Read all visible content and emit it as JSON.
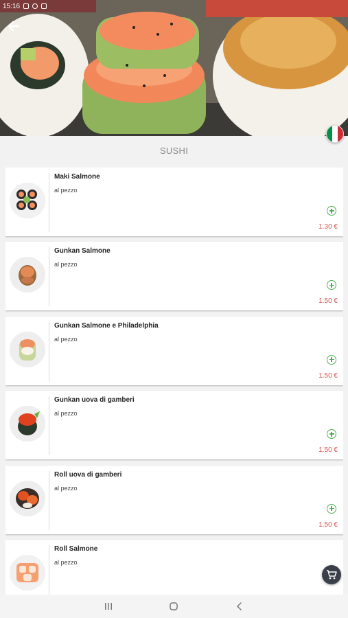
{
  "status_bar": {
    "time": "15:16"
  },
  "colors": {
    "accent_green": "#4caf50",
    "price_red": "#d9534f",
    "fab": "#3a3f4a"
  },
  "header": {
    "back_icon": "arrow-left-icon",
    "language_flag": "italian-flag-icon"
  },
  "section": {
    "title": "SUSHI"
  },
  "products": [
    {
      "name": "Maki Salmone",
      "unit": "al pezzo",
      "price": "1.30 €"
    },
    {
      "name": "Gunkan Salmone",
      "unit": "al pezzo",
      "price": "1.50 €"
    },
    {
      "name": "Gunkan Salmone e Philadelphia",
      "unit": "al pezzo",
      "price": "1.50 €"
    },
    {
      "name": "Gunkan uova di gamberi",
      "unit": "al pezzo",
      "price": "1.50 €"
    },
    {
      "name": "Roll uova di gamberi",
      "unit": "al pezzo",
      "price": "1.50 €"
    },
    {
      "name": "Roll Salmone",
      "unit": "al pezzo",
      "price": ""
    }
  ],
  "cart": {
    "icon": "cart-icon"
  },
  "nav": {
    "recent_icon": "recent-apps-icon",
    "home_icon": "home-icon",
    "back_icon": "back-chevron-icon"
  }
}
